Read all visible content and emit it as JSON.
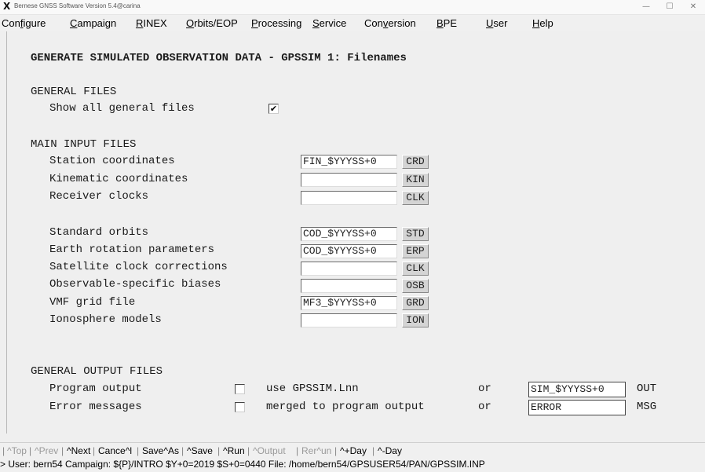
{
  "window": {
    "title": "Bernese GNSS Software Version 5.4@carina",
    "minimize": "—",
    "maximize": "☐",
    "close": "✕"
  },
  "menu": [
    {
      "pre": "Con",
      "ul": "f",
      "post": "igure"
    },
    {
      "pre": "",
      "ul": "C",
      "post": "ampaign"
    },
    {
      "pre": "",
      "ul": "R",
      "post": "INEX"
    },
    {
      "pre": "",
      "ul": "O",
      "post": "rbits/EOP"
    },
    {
      "pre": "",
      "ul": "P",
      "post": "rocessing"
    },
    {
      "pre": "",
      "ul": "S",
      "post": "ervice"
    },
    {
      "pre": "Con",
      "ul": "v",
      "post": "ersion"
    },
    {
      "pre": "",
      "ul": "B",
      "post": "PE"
    },
    {
      "pre": "",
      "ul": "U",
      "post": "ser"
    },
    {
      "pre": "",
      "ul": "H",
      "post": "elp"
    }
  ],
  "page_title": "GENERATE SIMULATED OBSERVATION DATA - GPSSIM 1: Filenames",
  "general_files": {
    "heading": "GENERAL FILES",
    "show_all_label": "Show all general files",
    "show_all_checked": "✔"
  },
  "main_input": {
    "heading": "MAIN INPUT FILES",
    "rows": [
      {
        "label": "Station coordinates",
        "value": "FIN_$YYYSS+0",
        "ext": "CRD"
      },
      {
        "label": "Kinematic coordinates",
        "value": "",
        "ext": "KIN"
      },
      {
        "label": "Receiver clocks",
        "value": "",
        "ext": "CLK"
      },
      {
        "label": "Standard orbits",
        "value": "COD_$YYYSS+0",
        "ext": "STD"
      },
      {
        "label": "Earth rotation parameters",
        "value": "COD_$YYYSS+0",
        "ext": "ERP"
      },
      {
        "label": "Satellite clock corrections",
        "value": "",
        "ext": "CLK"
      },
      {
        "label": "Observable-specific biases",
        "value": "",
        "ext": "OSB"
      },
      {
        "label": "VMF grid file",
        "value": "MF3_$YYYSS+0",
        "ext": "GRD"
      },
      {
        "label": "Ionosphere models",
        "value": "",
        "ext": "ION"
      }
    ]
  },
  "general_output": {
    "heading": "GENERAL OUTPUT FILES",
    "rows": [
      {
        "label": "Program output",
        "option": "use GPSSIM.Lnn",
        "or": "or",
        "value": "SIM_$YYYSS+0",
        "ext": "OUT"
      },
      {
        "label": "Error messages",
        "option": "merged to program output",
        "or": "or",
        "value": "ERROR",
        "ext": "MSG"
      }
    ]
  },
  "commands": [
    {
      "label": "^Top",
      "enabled": false
    },
    {
      "label": "^Prev",
      "enabled": false
    },
    {
      "label": "^Next",
      "enabled": true
    },
    {
      "label": "Cance^l",
      "enabled": true
    },
    {
      "label": "Save^As",
      "enabled": true
    },
    {
      "label": "^Save",
      "enabled": true
    },
    {
      "label": "^Run",
      "enabled": true
    },
    {
      "label": "^Output",
      "enabled": false
    },
    {
      "label": "Rer^un",
      "enabled": false
    },
    {
      "label": "^+Day",
      "enabled": true
    },
    {
      "label": "^-Day",
      "enabled": true
    }
  ],
  "status": "> User: bern54  Campaign: ${P}/INTRO  $Y+0=2019  $S+0=0440  File: /home/bern54/GPSUSER54/PAN/GPSSIM.INP"
}
